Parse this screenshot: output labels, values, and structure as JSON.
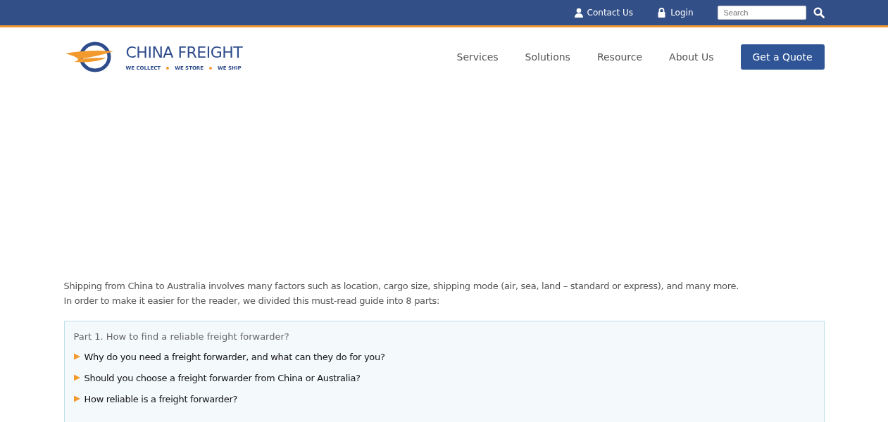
{
  "top_bar": {
    "links": [
      {
        "kind": "contact",
        "label": "Contact Us"
      },
      {
        "kind": "login",
        "label": "Login"
      }
    ],
    "search": {
      "placeholder": "Search"
    }
  },
  "header": {
    "logo": {
      "name": "CHINA FREIGHT",
      "tagline": [
        "WE COLLECT",
        "WE STORE",
        "WE SHIP"
      ]
    },
    "nav": [
      "Services",
      "Solutions",
      "Resource",
      "About Us"
    ],
    "cta": "Get a Quote"
  },
  "intro": [
    "Shipping from China to Australia involves many factors such as location, cargo size, shipping mode (air, sea, land – standard or express), and many more.",
    "In order to make it easier for the reader, we divided this must-read guide into 8 parts:"
  ],
  "guide": {
    "part_title": "Part 1. How to find a reliable freight forwarder?",
    "items": [
      "Why do you need a freight forwarder, and what can they do for you?",
      "Should you choose a freight forwarder from China or Australia?",
      "How reliable is a freight forwarder?"
    ]
  }
}
